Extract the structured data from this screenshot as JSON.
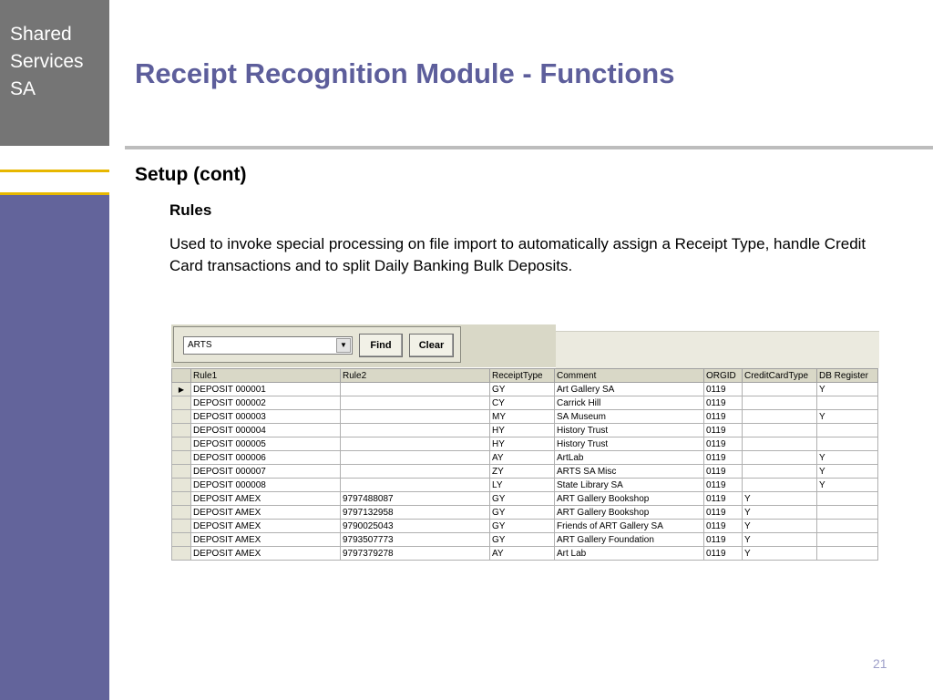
{
  "brand": {
    "line1": "Shared",
    "line2": "Services",
    "line3": "SA"
  },
  "title": "Receipt Recognition Module - Functions",
  "section": "Setup (cont)",
  "subsection": "Rules",
  "description": "Used to invoke special processing on file import to automatically assign a Receipt Type, handle Credit Card transactions and to split Daily Banking Bulk Deposits.",
  "toolbar": {
    "filter_value": "ARTS",
    "find_label": "Find",
    "clear_label": "Clear"
  },
  "grid": {
    "columns": [
      "Rule1",
      "Rule2",
      "ReceiptType",
      "Comment",
      "ORGID",
      "CreditCardType",
      "DB Register"
    ],
    "rows": [
      [
        "DEPOSIT 000001",
        "",
        "GY",
        "Art Gallery SA",
        "0119",
        "",
        "Y"
      ],
      [
        "DEPOSIT 000002",
        "",
        "CY",
        "Carrick Hill",
        "0119",
        "",
        ""
      ],
      [
        "DEPOSIT 000003",
        "",
        "MY",
        "SA Museum",
        "0119",
        "",
        "Y"
      ],
      [
        "DEPOSIT 000004",
        "",
        "HY",
        "History Trust",
        "0119",
        "",
        ""
      ],
      [
        "DEPOSIT 000005",
        "",
        "HY",
        "History Trust",
        "0119",
        "",
        ""
      ],
      [
        "DEPOSIT 000006",
        "",
        "AY",
        "ArtLab",
        "0119",
        "",
        "Y"
      ],
      [
        "DEPOSIT 000007",
        "",
        "ZY",
        "ARTS SA Misc",
        "0119",
        "",
        "Y"
      ],
      [
        "DEPOSIT 000008",
        "",
        "LY",
        "State Library SA",
        "0119",
        "",
        "Y"
      ],
      [
        "DEPOSIT AMEX",
        "9797488087",
        "GY",
        "ART Gallery Bookshop",
        "0119",
        "Y",
        ""
      ],
      [
        "DEPOSIT AMEX",
        "9797132958",
        "GY",
        "ART Gallery Bookshop",
        "0119",
        "Y",
        ""
      ],
      [
        "DEPOSIT AMEX",
        "9790025043",
        "GY",
        "Friends of ART Gallery SA",
        "0119",
        "Y",
        ""
      ],
      [
        "DEPOSIT AMEX",
        "9793507773",
        "GY",
        "ART Gallery Foundation",
        "0119",
        "Y",
        ""
      ],
      [
        "DEPOSIT AMEX",
        "9797379278",
        "AY",
        "Art Lab",
        "0119",
        "Y",
        ""
      ]
    ]
  },
  "page_number": "21"
}
